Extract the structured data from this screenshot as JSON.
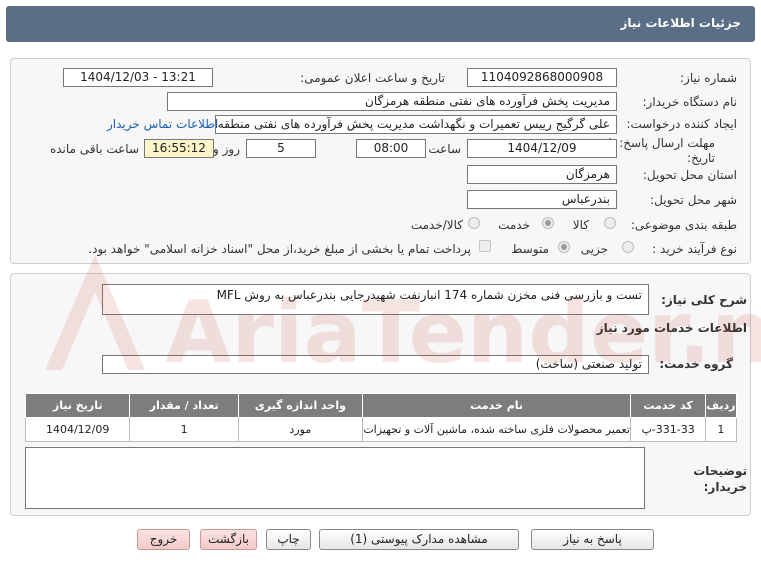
{
  "header": {
    "title": "جزئیات اطلاعات نیاز"
  },
  "form": {
    "need_number_label": "شماره نیاز:",
    "need_number": "1104092868000908",
    "announce_label": "تاریخ و ساعت اعلان عمومی:",
    "announce_value": "1404/12/03 - 13:21",
    "buyer_org_label": "نام دستگاه خریدار:",
    "buyer_org": "مدیریت پخش فرآورده های نفتی منطقه هرمزگان",
    "creator_label": "ایجاد کننده درخواست:",
    "creator": "علی گرگیج رییس تعمیرات و نگهداشت مدیریت پخش فرآورده های نفتی منطقه هرمزگان",
    "contact_link": "اطلاعات تماس خریدار",
    "deadline_label": "مهلت ارسال پاسخ: تا تاریخ:",
    "deadline_date": "1404/12/09",
    "time_label": "ساعت",
    "deadline_time": "08:00",
    "days_value": "5",
    "days_label": "روز و",
    "remaining_time": "16:55:12",
    "remaining_label": "ساعت باقی مانده",
    "province_label": "استان محل تحویل:",
    "province": "هرمزگان",
    "city_label": "شهر محل تحویل:",
    "city": "بندرعباس",
    "category_label": "طبقه بندی موضوعی:",
    "category_options": [
      "کالا",
      "خدمت",
      "کالا/خدمت"
    ],
    "category_selected": "خدمت",
    "process_label": "نوع فرآیند خرید :",
    "process_options": [
      "جزیی",
      "متوسط"
    ],
    "process_selected": "متوسط",
    "payment_note": "پرداخت تمام یا بخشی از مبلغ خرید،از محل \"اسناد خزانه اسلامی\" خواهد بود."
  },
  "details": {
    "summary_label": "شرح کلی نیاز:",
    "summary": "تست و بازرسی فنی مخزن شماره 174 انبارنفت شهیدرجایی بندرعباس  به روش MFL",
    "services_title": "اطلاعات خدمات مورد نیاز",
    "service_group_label": "گروه خدمت:",
    "service_group": "تولید صنعتی (ساخت)",
    "table": {
      "headers": [
        "ردیف",
        "کد خدمت",
        "نام خدمت",
        "واحد اندازه گیری",
        "تعداد / مقدار",
        "تاریخ نیاز"
      ],
      "rows": [
        [
          "1",
          "331-33-پ",
          "تعمیر محصولات فلزی ساخته شده، ماشین آلات و تجهیزات",
          "مورد",
          "1",
          "1404/12/09"
        ]
      ]
    },
    "buyer_notes_label": "توضیحات خریدار:",
    "buyer_notes": ""
  },
  "buttons": {
    "reply": "پاسخ به نیاز",
    "attachments": "مشاهده مدارک پیوستی (1)",
    "print": "چاپ",
    "back": "بازگشت",
    "exit": "خروج"
  },
  "colors": {
    "title_bar": "#5a6e85",
    "table_header": "#7d7d7d",
    "link": "#1a5fb4",
    "remaining_bg": "#fdf5c9"
  },
  "watermark": {
    "text": "AriaTender.net"
  }
}
